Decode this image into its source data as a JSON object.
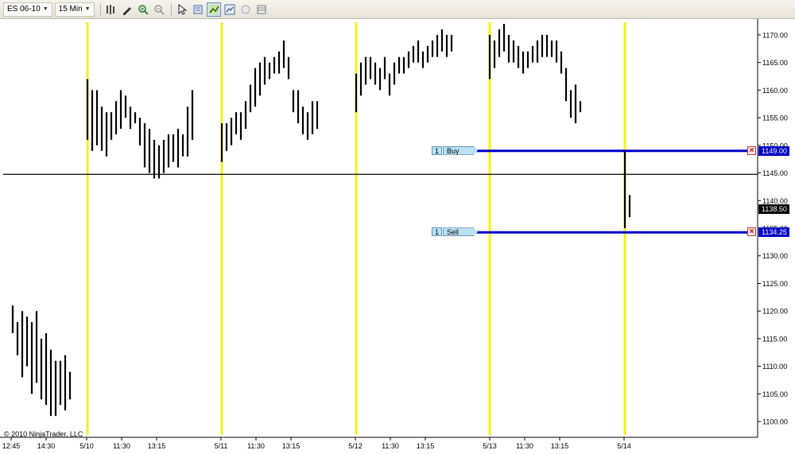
{
  "toolbar": {
    "instrument": "ES 06-10",
    "interval": "15 Min",
    "icons": [
      "bars-style-icon",
      "drawing-tool-icon",
      "zoom-in-icon",
      "zoom-out-icon",
      "pointer-icon",
      "data-box-icon",
      "chart-trader-icon",
      "properties-icon",
      "circle-icon",
      "panel-icon"
    ]
  },
  "chart": {
    "copyright": "© 2010 NinjaTrader, LLC",
    "y_axis": {
      "min": 1100,
      "max": 1170,
      "step": 5,
      "tick_labels": [
        "1170.00",
        "1165.00",
        "1160.00",
        "1155.00",
        "1150.00",
        "1145.00",
        "1140.00",
        "1135.00",
        "1130.00",
        "1125.00",
        "1120.00",
        "1115.00",
        "1110.00",
        "1105.00",
        "1100.00"
      ]
    },
    "x_axis_labels": [
      "12:45",
      "14:30",
      "5/10",
      "11:30",
      "13:15",
      "5/11",
      "11:30",
      "13:15",
      "5/12",
      "11:30",
      "13:15",
      "5/13",
      "11:30",
      "13:15",
      "5/14"
    ],
    "session_break_color": "#f2f21a",
    "horizontal_line_price": 1144.75,
    "last_price": "1138.50",
    "orders": [
      {
        "qty": "1",
        "type": "Buy STP",
        "price_label": "1149.00",
        "price": 1149.0,
        "color": "#0000c8"
      },
      {
        "qty": "1",
        "type": "Sell STP",
        "price_label": "1134.25",
        "price": 1134.25,
        "color": "#0000c8"
      }
    ]
  },
  "chart_data": {
    "type": "bar",
    "description_series": "price",
    "ylim": [
      1098,
      1172
    ],
    "sessions": [
      {
        "label": "pre",
        "bars": [
          [
            1116,
            1121
          ],
          [
            1112,
            1118
          ],
          [
            1108,
            1120
          ],
          [
            1110,
            1119
          ],
          [
            1105,
            1118
          ],
          [
            1107,
            1120
          ],
          [
            1104,
            1115
          ],
          [
            1103,
            1116
          ],
          [
            1101,
            1113
          ],
          [
            1101,
            1111
          ],
          [
            1103,
            1111
          ],
          [
            1102,
            1112
          ],
          [
            1104,
            1109
          ]
        ]
      },
      {
        "label": "5/10",
        "bars": [
          [
            1151,
            1162
          ],
          [
            1149,
            1160
          ],
          [
            1150,
            1160
          ],
          [
            1149,
            1157
          ],
          [
            1148,
            1156
          ],
          [
            1151,
            1156
          ],
          [
            1152,
            1158
          ],
          [
            1153,
            1160
          ],
          [
            1155,
            1159
          ],
          [
            1153,
            1157
          ],
          [
            1154,
            1156
          ],
          [
            1150,
            1155
          ],
          [
            1146,
            1154
          ],
          [
            1145,
            1153
          ],
          [
            1144,
            1151
          ],
          [
            1144,
            1150
          ],
          [
            1145,
            1151
          ],
          [
            1146,
            1152
          ],
          [
            1147,
            1152
          ],
          [
            1146,
            1153
          ],
          [
            1148,
            1152
          ],
          [
            1148,
            1157
          ],
          [
            1151,
            1160
          ]
        ]
      },
      {
        "label": "5/11",
        "bars": [
          [
            1147,
            1154
          ],
          [
            1149,
            1154
          ],
          [
            1150,
            1155
          ],
          [
            1152,
            1156
          ],
          [
            1151,
            1156
          ],
          [
            1153,
            1158
          ],
          [
            1156,
            1161
          ],
          [
            1157,
            1164
          ],
          [
            1159,
            1165
          ],
          [
            1161,
            1166
          ],
          [
            1162,
            1165
          ],
          [
            1163,
            1166
          ],
          [
            1163,
            1167
          ],
          [
            1164,
            1169
          ],
          [
            1162,
            1166
          ],
          [
            1156,
            1160
          ],
          [
            1154,
            1160
          ],
          [
            1152,
            1157
          ],
          [
            1151,
            1156
          ],
          [
            1152,
            1158
          ],
          [
            1153,
            1158
          ]
        ]
      },
      {
        "label": "5/12",
        "bars": [
          [
            1156,
            1163
          ],
          [
            1159,
            1165
          ],
          [
            1161,
            1166
          ],
          [
            1162,
            1166
          ],
          [
            1161,
            1165
          ],
          [
            1160,
            1164
          ],
          [
            1162,
            1166
          ],
          [
            1159,
            1163
          ],
          [
            1161,
            1165
          ],
          [
            1163,
            1166
          ],
          [
            1163,
            1166
          ],
          [
            1164,
            1167
          ],
          [
            1165,
            1168
          ],
          [
            1165,
            1169
          ],
          [
            1164,
            1167
          ],
          [
            1165,
            1168
          ],
          [
            1166,
            1169
          ],
          [
            1166,
            1170
          ],
          [
            1167,
            1171
          ],
          [
            1166,
            1170
          ],
          [
            1167,
            1170
          ]
        ]
      },
      {
        "label": "5/13",
        "bars": [
          [
            1162,
            1170
          ],
          [
            1164,
            1169
          ],
          [
            1166,
            1171
          ],
          [
            1167,
            1172
          ],
          [
            1165,
            1170
          ],
          [
            1165,
            1169
          ],
          [
            1164,
            1168
          ],
          [
            1163,
            1167
          ],
          [
            1164,
            1167
          ],
          [
            1165,
            1168
          ],
          [
            1165,
            1169
          ],
          [
            1166,
            1170
          ],
          [
            1166,
            1170
          ],
          [
            1166,
            1169
          ],
          [
            1165,
            1169
          ],
          [
            1163,
            1167
          ],
          [
            1158,
            1164
          ],
          [
            1155,
            1160
          ],
          [
            1154,
            1161
          ],
          [
            1156,
            1158
          ]
        ]
      },
      {
        "label": "5/14",
        "bars": [
          [
            1135,
            1149
          ],
          [
            1137,
            1141
          ]
        ]
      }
    ]
  }
}
